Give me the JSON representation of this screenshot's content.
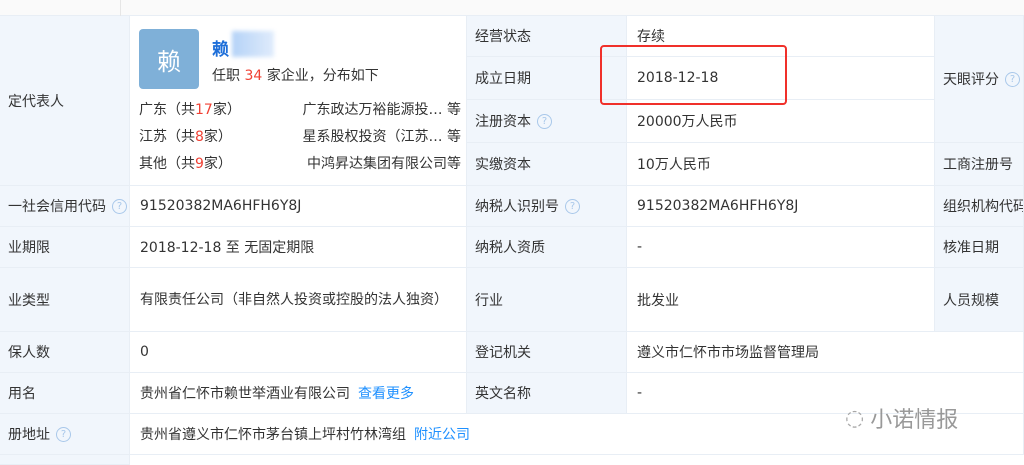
{
  "legal_rep": {
    "label": "定代表人",
    "avatar_char": "赖",
    "name": "赖",
    "summary_pre": "任职 ",
    "summary_count": "34",
    "summary_post": " 家企业，分布如下",
    "distribution": [
      {
        "prefix": "广东（共",
        "count": "17",
        "suffix": "家）",
        "companies": "广东政达万裕能源投…  等"
      },
      {
        "prefix": "江苏（共",
        "count": "8",
        "suffix": "家）",
        "companies": "星系股权投资（江苏…  等"
      },
      {
        "prefix": "其他（共",
        "count": "9",
        "suffix": "家）",
        "companies": "中鸿昇达集团有限公司等"
      }
    ]
  },
  "left_rows": [
    {
      "label": "一社会信用代码",
      "value": "91520382MA6HFH6Y8J"
    },
    {
      "label": "业期限",
      "value": "2018-12-18  至 无固定期限"
    },
    {
      "label": "业类型",
      "value": "有限责任公司（非自然人投资或控股的法人独资）"
    },
    {
      "label": "保人数",
      "value": "0"
    },
    {
      "label": "用名",
      "value": "贵州省仁怀市赖世举酒业有限公司",
      "link": "查看更多"
    },
    {
      "label": "册地址",
      "value": "贵州省遵义市仁怀市茅台镇上坪村竹林湾组",
      "link": "附近公司"
    }
  ],
  "mid_rows": [
    {
      "label": "经营状态",
      "value": "存续"
    },
    {
      "label": "成立日期",
      "value": "2018-12-18"
    },
    {
      "label": "注册资本",
      "value": "20000万人民币"
    },
    {
      "label": "实缴资本",
      "value": "10万人民币"
    },
    {
      "label": "纳税人识别号",
      "value": "91520382MA6HFH6Y8J"
    },
    {
      "label": "纳税人资质",
      "value": "-"
    },
    {
      "label": "行业",
      "value": "批发业"
    },
    {
      "label": "登记机关",
      "value": "遵义市仁怀市市场监督管理局"
    },
    {
      "label": "英文名称",
      "value": "-"
    }
  ],
  "right_labels": [
    "天眼评分",
    "工商注册号",
    "组织机构代码",
    "核准日期",
    "人员规模"
  ],
  "watermark": "小诺情报"
}
